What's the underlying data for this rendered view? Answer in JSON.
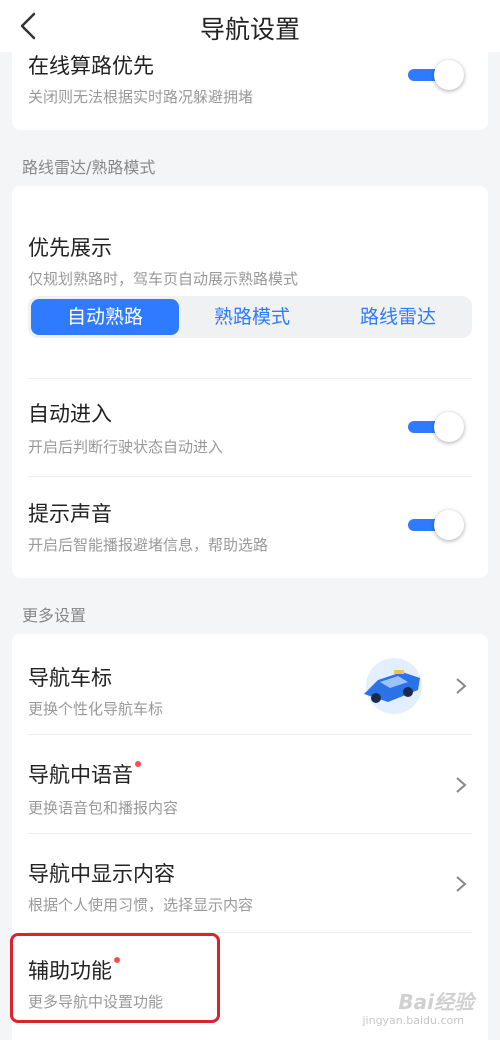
{
  "header": {
    "title": "导航设置"
  },
  "card1": {
    "title": "在线算路优先",
    "subtitle": "关闭则无法根据实时路况躲避拥堵",
    "toggle_on": true
  },
  "section_route": "路线雷达/熟路模式",
  "priority": {
    "title": "优先展示",
    "subtitle": "仅规划熟路时，驾车页自动展示熟路模式",
    "options": [
      "自动熟路",
      "熟路模式",
      "路线雷达"
    ],
    "selected": "自动熟路"
  },
  "auto_enter": {
    "title": "自动进入",
    "subtitle": "开启后判断行驶状态自动进入",
    "toggle_on": true
  },
  "sound": {
    "title": "提示声音",
    "subtitle": "开启后智能播报避堵信息，帮助选路",
    "toggle_on": true
  },
  "section_more": "更多设置",
  "more_items": [
    {
      "title": "导航车标",
      "subtitle": "更换个性化导航车标",
      "badge": false
    },
    {
      "title": "导航中语音",
      "subtitle": "更换语音包和播报内容",
      "badge": true
    },
    {
      "title": "导航中显示内容",
      "subtitle": "根据个人使用习惯，选择显示内容",
      "badge": false
    },
    {
      "title": "辅助功能",
      "subtitle": "更多导航中设置功能",
      "badge": true
    }
  ],
  "watermark": {
    "brand": "Bai经验",
    "url": "jingyan.baidu.com"
  },
  "colors": {
    "accent": "#2f7bff",
    "badge": "#ff4d4f",
    "highlight": "#d9232e"
  }
}
